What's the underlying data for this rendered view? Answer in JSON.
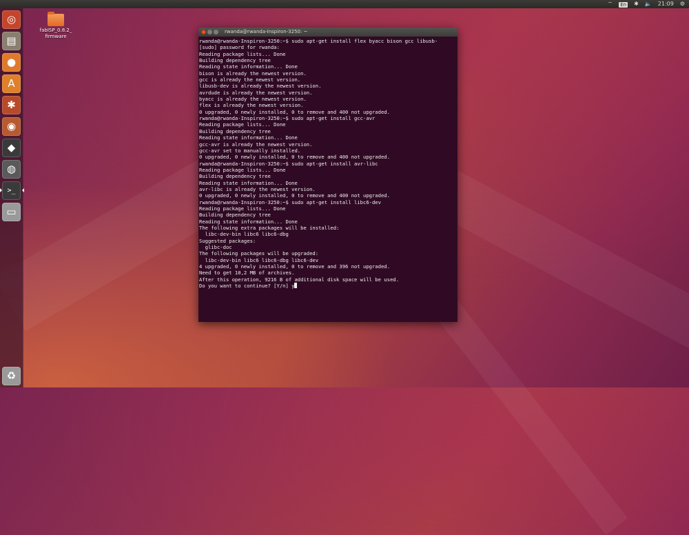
{
  "topbar": {
    "indicators": [
      {
        "icon": "wifi-icon",
        "text": "⌔"
      },
      {
        "icon": "keyboard-layout-icon",
        "text": "En"
      },
      {
        "icon": "bluetooth-icon",
        "text": "✱"
      },
      {
        "icon": "volume-icon",
        "text": "🔈"
      },
      {
        "icon": "clock",
        "text": "21:09"
      },
      {
        "icon": "gear-icon",
        "text": "⚙"
      }
    ]
  },
  "launcher": {
    "items": [
      {
        "name": "ubuntu-dash-icon",
        "glyph": "◎",
        "bg": "#c4452b"
      },
      {
        "name": "files-icon",
        "glyph": "▤",
        "bg": "#8a7e6f"
      },
      {
        "name": "firefox-icon",
        "glyph": "●",
        "bg": "#e07a2b"
      },
      {
        "name": "software-center-icon",
        "glyph": "A",
        "bg": "#e0802a"
      },
      {
        "name": "system-settings-icon",
        "glyph": "✱",
        "bg": "#b84a2a"
      },
      {
        "name": "blender-icon",
        "glyph": "◉",
        "bg": "#b85a30"
      },
      {
        "name": "inkscape-icon",
        "glyph": "◆",
        "bg": "#3a3a3a"
      },
      {
        "name": "camera-icon",
        "glyph": "◍",
        "bg": "#5a5a5a"
      },
      {
        "name": "terminal-icon",
        "glyph": ">_",
        "bg": "#3a3a3a"
      },
      {
        "name": "drive-icon",
        "glyph": "▭",
        "bg": "#9a9a9a"
      }
    ],
    "trash": {
      "name": "trash-icon",
      "glyph": "♻",
      "bg": "#9a9a9a"
    }
  },
  "desktop": {
    "folder_label_line1": "fabISP_0.8.2_",
    "folder_label_line2": "firmware"
  },
  "terminal": {
    "title": "rwanda@rwanda-Inspiron-3250: ~",
    "lines": [
      "rwanda@rwanda-Inspiron-3250:~$ sudo apt-get install flex byacc bison gcc libusb-",
      "[sudo] password for rwanda:",
      "Reading package lists... Done",
      "Building dependency tree",
      "Reading state information... Done",
      "bison is already the newest version.",
      "gcc is already the newest version.",
      "libusb-dev is already the newest version.",
      "avrdude is already the newest version.",
      "byacc is already the newest version.",
      "flex is already the newest version.",
      "0 upgraded, 0 newly installed, 0 to remove and 400 not upgraded.",
      "rwanda@rwanda-Inspiron-3250:~$ sudo apt-get install gcc-avr",
      "Reading package lists... Done",
      "Building dependency tree",
      "Reading state information... Done",
      "gcc-avr is already the newest version.",
      "gcc-avr set to manually installed.",
      "0 upgraded, 0 newly installed, 0 to remove and 400 not upgraded.",
      "rwanda@rwanda-Inspiron-3250:~$ sudo apt-get install avr-libc",
      "Reading package lists... Done",
      "Building dependency tree",
      "Reading state information... Done",
      "avr-libc is already the newest version.",
      "0 upgraded, 0 newly installed, 0 to remove and 400 not upgraded.",
      "rwanda@rwanda-Inspiron-3250:~$ sudo apt-get install libc6-dev",
      "Reading package lists... Done",
      "Building dependency tree",
      "Reading state information... Done",
      "The following extra packages will be installed:",
      "  libc-dev-bin libc6 libc6-dbg",
      "Suggested packages:",
      "  glibc-doc",
      "The following packages will be upgraded:",
      "  libc-dev-bin libc6 libc6-dbg libc6-dev",
      "4 upgraded, 0 newly installed, 0 to remove and 396 not upgraded.",
      "Need to get 10,2 MB of archives.",
      "After this operation, 9216 B of additional disk space will be used."
    ],
    "prompt_line": "Do you want to continue? [Y/n] y"
  }
}
